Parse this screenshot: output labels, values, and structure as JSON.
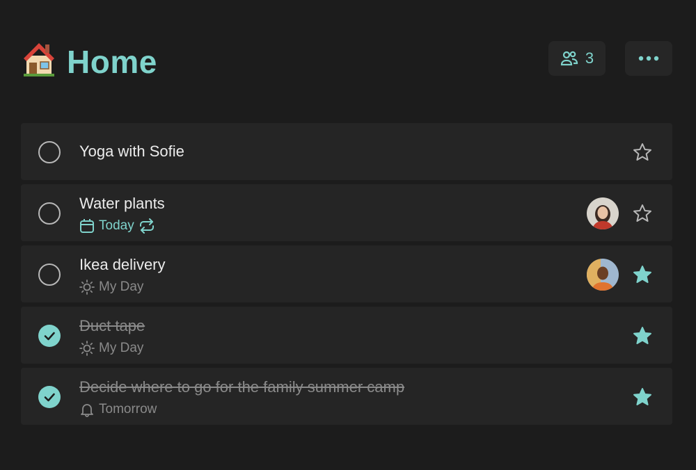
{
  "header": {
    "title": "Home",
    "share_count": "3",
    "icons": {
      "list_icon": "house-emoji",
      "share": "people-icon",
      "more": "more-dots-icon"
    }
  },
  "colors": {
    "accent": "#7fd3cc",
    "background": "#1c1c1c",
    "row": "#252525",
    "muted": "#8a8a8a"
  },
  "tasks": [
    {
      "title": "Yoga with Sofie",
      "completed": false,
      "starred": false,
      "meta": null,
      "assigned": false
    },
    {
      "title": "Water plants",
      "completed": false,
      "starred": false,
      "meta": {
        "label": "Today",
        "icon": "calendar-icon",
        "repeat": true
      },
      "assigned": true
    },
    {
      "title": "Ikea delivery",
      "completed": false,
      "starred": true,
      "meta": {
        "label": "My Day",
        "icon": "sun-icon"
      },
      "assigned": true
    },
    {
      "title": "Duct tape",
      "completed": true,
      "starred": true,
      "meta": {
        "label": "My Day",
        "icon": "sun-icon"
      },
      "assigned": false
    },
    {
      "title": "Decide where to go for the family summer camp",
      "completed": true,
      "starred": true,
      "meta": {
        "label": "Tomorrow",
        "icon": "bell-icon"
      },
      "assigned": false
    }
  ]
}
